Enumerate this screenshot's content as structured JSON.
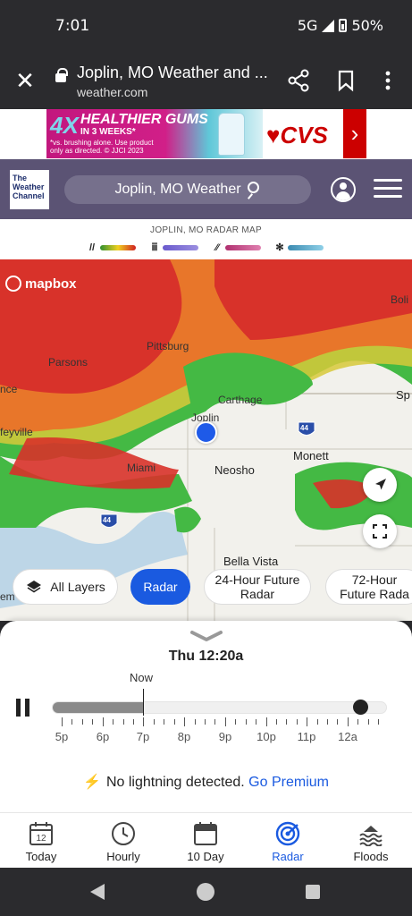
{
  "status_bar": {
    "time": "7:01",
    "network": "5G",
    "battery": "50%"
  },
  "browser": {
    "title": "Joplin, MO Weather and ...",
    "url": "weather.com"
  },
  "ad": {
    "logo": "4X",
    "headline": "HEALTHIER GUMS",
    "sub": "IN 3 WEEKS*",
    "fine_print": "*vs. brushing alone. Use product only as directed. © JJCI 2023",
    "brand": "CVS"
  },
  "header": {
    "logo_text": "The Weather Channel",
    "search_text": "Joplin, MO Weather"
  },
  "legend": {
    "title": "JOPLIN, MO RADAR MAP",
    "items": [
      {
        "icon": "rain-icon",
        "colors": [
          "#2f8f2f",
          "#f0d020",
          "#d02020"
        ]
      },
      {
        "icon": "mix-icon",
        "colors": [
          "#6a5acd",
          "#9b8fe0"
        ]
      },
      {
        "icon": "ice-icon",
        "colors": [
          "#b0306f",
          "#e080b0"
        ]
      },
      {
        "icon": "snow-icon",
        "colors": [
          "#3a8ab0",
          "#8fd0e8"
        ]
      }
    ]
  },
  "map": {
    "attribution": "mapbox",
    "cities": {
      "pittsburg": "Pittsburg",
      "parsons": "Parsons",
      "carthage": "Carthage",
      "joplin": "Joplin",
      "monett": "Monett",
      "miami": "Miami",
      "neosho": "Neosho",
      "bella_vista": "Bella Vista",
      "bolivar_partial": "Boli",
      "springfield_partial": "Sp",
      "chanute_partial": "nce",
      "coffeyville_partial": "feyville",
      "bentonville_partial": "em"
    },
    "interstate": "44",
    "layer_chips": {
      "all_layers": "All Layers",
      "radar": "Radar",
      "future_24": "24-Hour Future Radar",
      "future_72": "72-Hour Future Rada"
    }
  },
  "timeline": {
    "current_time": "Thu 12:20a",
    "now_label": "Now",
    "tick_labels": [
      "5p",
      "6p",
      "7p",
      "8p",
      "9p",
      "10p",
      "11p",
      "12a"
    ],
    "played_fraction": 0.27,
    "position_fraction": 0.92
  },
  "lightning": {
    "message": "No lightning detected.",
    "link": "Go Premium"
  },
  "bottom_nav": {
    "today": {
      "label": "Today",
      "date": "12"
    },
    "hourly": {
      "label": "Hourly"
    },
    "ten_day": {
      "label": "10 Day"
    },
    "radar": {
      "label": "Radar"
    },
    "floods": {
      "label": "Floods"
    }
  },
  "colors": {
    "accent": "#1a5ae0",
    "header_bg": "#5b5374",
    "radar_green": "#3fbf3f",
    "radar_red": "#d8322a",
    "radar_orange": "#e8762a"
  }
}
